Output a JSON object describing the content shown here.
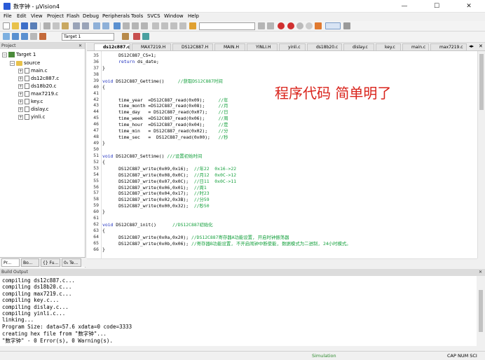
{
  "window": {
    "title": "数字钟 - µVision4",
    "min": "—",
    "max": "☐",
    "close": "✕"
  },
  "menu": [
    "File",
    "Edit",
    "View",
    "Project",
    "Flash",
    "Debug",
    "Peripherals",
    "Tools",
    "SVCS",
    "Window",
    "Help"
  ],
  "toolbar": {
    "target_value": "Target 1"
  },
  "project_panel": {
    "header": "Project",
    "target": "Target 1",
    "group": "source",
    "files": [
      "main.c",
      "ds12c887.c",
      "ds18b20.c",
      "max7219.c",
      "key.c",
      "dislay.c",
      "yinli.c"
    ],
    "tabs": [
      "Pr...",
      "Bo...",
      "{} Fu...",
      "0₀ Te..."
    ]
  },
  "editor_tabs": [
    "ds12c887.c",
    "MAX7219.H",
    "DS12C887.H",
    "MAIN.H",
    "YINLI.H",
    "yinli.c",
    "ds18b20.c",
    "dislay.c",
    "key.c",
    "main.c",
    "max7219.c"
  ],
  "code_lines": [
    {
      "n": "35",
      "t": "      DS12C887_CS=1;"
    },
    {
      "n": "36",
      "t": "      return ds_date;"
    },
    {
      "n": "37",
      "t": "}"
    },
    {
      "n": "38",
      "t": ""
    },
    {
      "n": "39",
      "t": "void DS12C887_Gettime()     //获取DS12C887时间"
    },
    {
      "n": "40",
      "t": "{"
    },
    {
      "n": "41",
      "t": ""
    },
    {
      "n": "42",
      "t": "      time_year  =DS12C887_read(0x09);     //年"
    },
    {
      "n": "43",
      "t": "      time_month =DS12C887_read(0x08);     //月"
    },
    {
      "n": "44",
      "t": "      time_day   = DS12C887_read(0x07);    //日"
    },
    {
      "n": "45",
      "t": "      time_week  =DS12C887_read(0x06);     //周"
    },
    {
      "n": "46",
      "t": "      time_hour  =DS12C887_read(0x04);     //是"
    },
    {
      "n": "47",
      "t": "      time_min   = DS12C887_read(0x02);    //分"
    },
    {
      "n": "48",
      "t": "      time_sec   =  DS12C887_read(0x00);   //秒"
    },
    {
      "n": "49",
      "t": "}"
    },
    {
      "n": "50",
      "t": ""
    },
    {
      "n": "51",
      "t": "void DS12C887_Settime() ///设置初始时间"
    },
    {
      "n": "52",
      "t": "{"
    },
    {
      "n": "53",
      "t": "      DS12C887_write(0x09,0x16);  //年22  0x16->22"
    },
    {
      "n": "54",
      "t": "      DS12C887_write(0x08,0x0C);  //月12  0x0C->12"
    },
    {
      "n": "55",
      "t": "      DS12C887_write(0x07,0x0C);  //日11  0x0C->11"
    },
    {
      "n": "56",
      "t": "      DS12C887_write(0x06,0x01);  //周1"
    },
    {
      "n": "57",
      "t": "      DS12C887_write(0x04,0x17);  //时23"
    },
    {
      "n": "58",
      "t": "      DS12C887_write(0x02,0x3B);  //分59"
    },
    {
      "n": "59",
      "t": "      DS12C887_write(0x00,0x32);  //秒50"
    },
    {
      "n": "60",
      "t": "}"
    },
    {
      "n": "61",
      "t": ""
    },
    {
      "n": "62",
      "t": "void DS12C887_init()      //DS12C887初始化"
    },
    {
      "n": "63",
      "t": "{"
    },
    {
      "n": "64",
      "t": "      DS12C887_write(0x0a,0x20); //DS12C887寄存器A功能设置, 开启时钟振荡器"
    },
    {
      "n": "65",
      "t": "      DS12C887_write(0x0b,0x06); //寄存器B功能设置, 不开启闹钟中断使能, 数据模式为二进制, 24小时模式。"
    },
    {
      "n": "66",
      "t": "}"
    }
  ],
  "overlay_text": "程序代码 简单明了",
  "build_output": {
    "header": "Build Output",
    "lines": [
      "compiling ds12c887.c...",
      "compiling ds18b20.c...",
      "compiling max7219.c...",
      "compiling key.c...",
      "compiling dislay.c...",
      "compiling yinli.c...",
      "linking...",
      "Program Size: data=57.6 xdata=0 code=3333",
      "creating hex file from \"数字钟\"...",
      "\"数字钟\" - 0 Error(s), 0 Warning(s)."
    ]
  },
  "status": {
    "mode": "Simulation",
    "indicators": "CAP  NUM  SCI"
  },
  "colors": {
    "keyword": "#1e2fbe",
    "comment": "#14a03c",
    "overlay": "#d9231b",
    "status_mode": "#2e8b2e"
  }
}
